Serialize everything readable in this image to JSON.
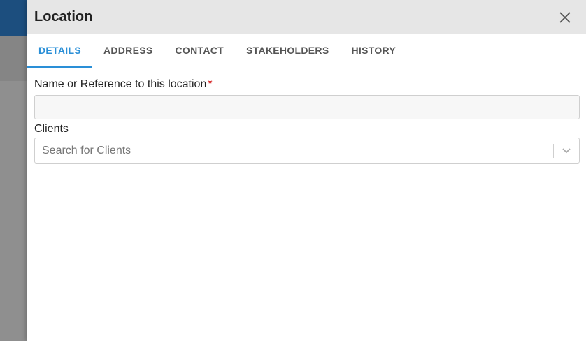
{
  "drawer": {
    "title": "Location",
    "close_icon": "close-icon"
  },
  "tabs": [
    {
      "label": "DETAILS",
      "active": true
    },
    {
      "label": "ADDRESS",
      "active": false
    },
    {
      "label": "CONTACT",
      "active": false
    },
    {
      "label": "STAKEHOLDERS",
      "active": false
    },
    {
      "label": "HISTORY",
      "active": false
    }
  ],
  "form": {
    "name_label": "Name or Reference to this location",
    "required_mark": "*",
    "name_value": "",
    "clients_label": "Clients",
    "clients_placeholder": "Search for Clients"
  },
  "colors": {
    "accent": "#2a8fd7",
    "required": "#d42020",
    "header_bg": "#e6e6e6"
  }
}
